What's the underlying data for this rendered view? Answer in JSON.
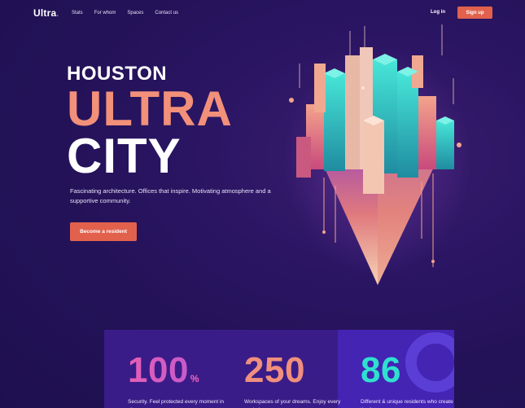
{
  "nav": {
    "logo": "Ultra",
    "logo_dot": ".",
    "links": [
      "Stats",
      "For whom",
      "Spaces",
      "Contact us"
    ],
    "login": "Log in",
    "signup": "Sign up"
  },
  "hero": {
    "line1": "HOUSTON",
    "line2": "ULTRA",
    "line3": "CITY",
    "description": "Fascinating architecture. Offices that inspire. Motivating atmosphere and a supportive community.",
    "cta": "Become a resident"
  },
  "stats": [
    {
      "value": "100",
      "suffix": "%",
      "label": "Security. Feel protected every moment in city."
    },
    {
      "value": "250",
      "suffix": "",
      "label": "Workspaces of your dreams. Enjoy every work days."
    },
    {
      "value": "86",
      "suffix": "",
      "label": "Different & unique residents who create the future."
    }
  ],
  "colors": {
    "accent": "#e1614d",
    "salmon": "#f2907a",
    "teal": "#2fd8c8",
    "magenta": "#d94fb0",
    "bg": "#241258"
  }
}
